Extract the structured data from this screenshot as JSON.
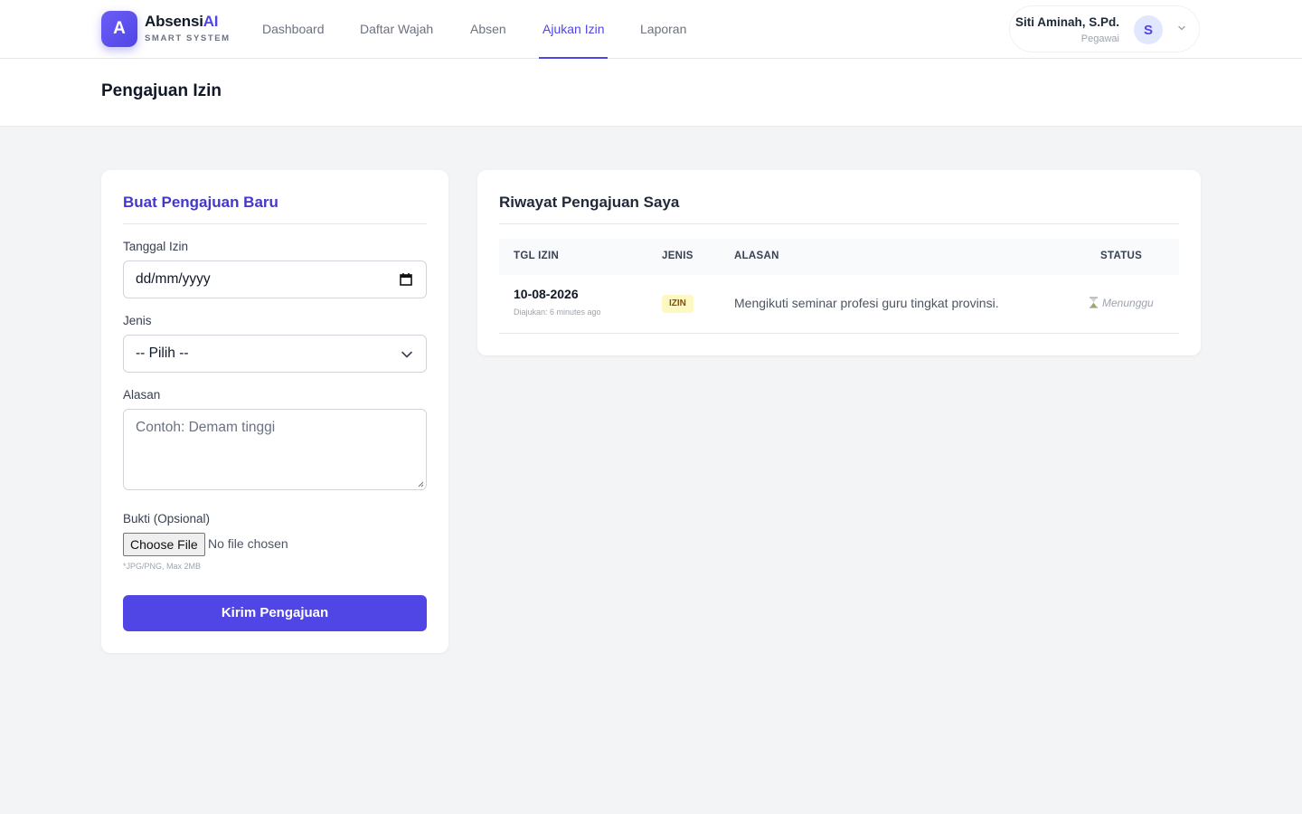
{
  "brand": {
    "initial": "A",
    "name_main": "Absensi",
    "name_accent": "AI",
    "subtitle": "SMART SYSTEM"
  },
  "nav": {
    "items": [
      {
        "label": "Dashboard",
        "active": false
      },
      {
        "label": "Daftar Wajah",
        "active": false
      },
      {
        "label": "Absen",
        "active": false
      },
      {
        "label": "Ajukan Izin",
        "active": true
      },
      {
        "label": "Laporan",
        "active": false
      }
    ]
  },
  "user": {
    "name": "Siti Aminah, S.Pd.",
    "role": "Pegawai",
    "avatar_initial": "S"
  },
  "page": {
    "title": "Pengajuan Izin"
  },
  "form": {
    "title": "Buat Pengajuan Baru",
    "date_label": "Tanggal Izin",
    "date_value": "dd/mm/yyyy",
    "type_label": "Jenis",
    "type_value": "-- Pilih --",
    "reason_label": "Alasan",
    "reason_placeholder": "Contoh: Demam tinggi",
    "proof_label": "Bukti (Opsional)",
    "file_button": "Choose File",
    "file_status": "No file chosen",
    "file_hint": "*JPG/PNG, Max 2MB",
    "submit_label": "Kirim Pengajuan"
  },
  "history": {
    "title": "Riwayat Pengajuan Saya",
    "columns": [
      "TGL IZIN",
      "JENIS",
      "ALASAN",
      "STATUS"
    ],
    "rows": [
      {
        "date": "10-08-2026",
        "submitted": "Diajukan: 6 minutes ago",
        "type": "IZIN",
        "reason": "Mengikuti seminar profesi guru tingkat provinsi.",
        "status": "Menunggu"
      }
    ]
  },
  "colors": {
    "accent": "#4f46e5",
    "badge_bg": "#fef9c3",
    "badge_text": "#854d0e",
    "page_bg": "#f3f4f6"
  },
  "icons": {
    "calendar": "calendar-icon",
    "select": "chevron-down-icon",
    "status": "hourglass-icon",
    "user_menu": "chevron-down-icon"
  }
}
